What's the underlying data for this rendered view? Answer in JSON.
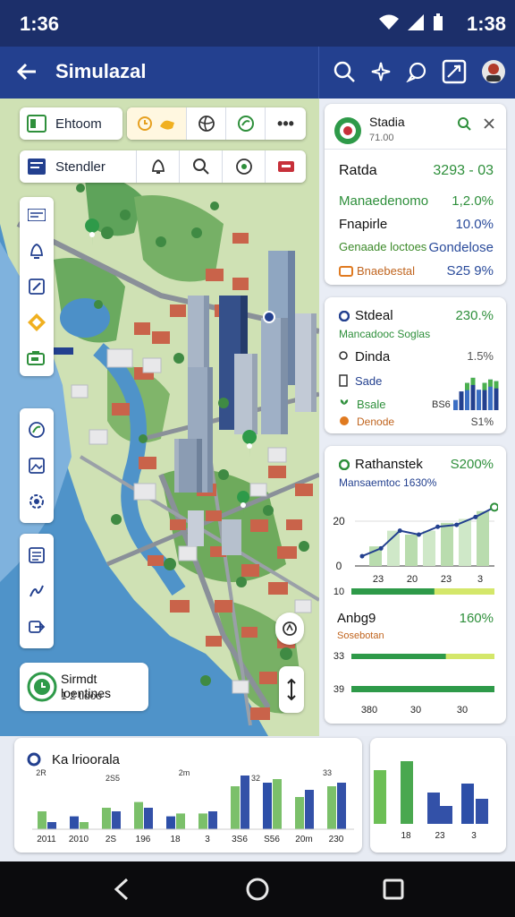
{
  "status": {
    "time_left": "1:36",
    "time_right": "1:38"
  },
  "appbar": {
    "title": "Simulazal"
  },
  "map": {
    "toolbar1": {
      "label": "Ehtoom"
    },
    "toolbar2": {
      "label": "Stendler"
    },
    "info": {
      "title": "Sirmdt loentines",
      "sub": "1 2 tidoo"
    }
  },
  "panel": {
    "header": {
      "title": "Stadia",
      "sub": "71.00"
    },
    "stats": {
      "title": "Ratda",
      "title_value": "3293 - 03",
      "rows": [
        {
          "label": "Manaedenomo",
          "value": "1,2.0%"
        },
        {
          "label": "Fnapirle",
          "value": "10.0%"
        },
        {
          "label": "Genaade loctoes",
          "value": "Gondelose"
        },
        {
          "label": "Bnaebestal",
          "value": "S25 9%"
        }
      ]
    },
    "stock": {
      "title": "Stdeal",
      "title_value": "230.%",
      "sub": "Mancadooc Soglas",
      "rows": [
        {
          "label": "Dinda",
          "value": "1.5%"
        },
        {
          "label": "Sade",
          "value": ""
        },
        {
          "label": "Bsale",
          "value": "BS6"
        },
        {
          "label": "Denode",
          "value": "S1%"
        }
      ],
      "bars": [
        0.3,
        0.55,
        0.8,
        0.95,
        0.6,
        0.8,
        0.9,
        0.85
      ]
    },
    "trend": {
      "title": "Rathanstek",
      "title_value": "S200%",
      "sub": "Mansaemtoc 1630%",
      "y_ticks": [
        "20",
        "0"
      ],
      "x_ticks": [
        "23",
        "20",
        "23",
        "3"
      ],
      "line": [
        5,
        9,
        18,
        16,
        20,
        21,
        25,
        30
      ],
      "bars": [
        10,
        18,
        16,
        18,
        22,
        24,
        28
      ]
    },
    "progress": {
      "rows": [
        {
          "label": "10",
          "value": 1.0
        },
        {
          "label": "Anbg9",
          "value": 0.66,
          "right": "160%",
          "sub": "Sosebotan"
        },
        {
          "label": "39",
          "value": 1.0
        }
      ],
      "x_ticks": [
        "380",
        "30",
        "30"
      ],
      "y_top": "33"
    }
  },
  "bottom": {
    "title": "Ka lrioorala",
    "chart_data": {
      "type": "bar",
      "categories": [
        "2011",
        "2010",
        "2S",
        "196",
        "18",
        "3",
        "3S6",
        "S56",
        "20m",
        "230"
      ],
      "series": [
        {
          "name": "",
          "values": [
            25,
            18,
            30,
            38,
            18,
            22,
            60,
            65,
            45,
            60
          ]
        },
        {
          "name": "",
          "values": [
            10,
            10,
            25,
            30,
            22,
            25,
            75,
            70,
            55,
            65
          ]
        }
      ],
      "labels_top": [
        "2R",
        "2S5",
        "2m",
        "32",
        "33"
      ]
    },
    "chart2": {
      "x_ticks": [
        "18",
        "23",
        "3"
      ],
      "values": [
        60,
        70,
        35,
        45
      ]
    }
  }
}
